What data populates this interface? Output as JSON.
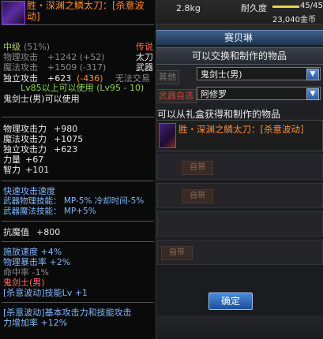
{
  "topbar": {
    "weight": "2.8kg",
    "durability_label": "耐久度",
    "durability_value": "45/45",
    "gold": "23,040金币"
  },
  "craft_window": {
    "title": "赛贝琳",
    "subtitle": "可以交换和制作的物品",
    "class_select": "鬼剑士(男)",
    "subclass_select": "阿修罗",
    "ghost_tab_1": "其他",
    "ghost_tab_2": "武器自选",
    "source_label": "可以从礼盒获得和制作的物品",
    "item_name": "胜・深渊之鳞太刀：[杀意波动]",
    "ghost_btn_1": "自带",
    "ghost_btn_2": "自带",
    "ghost_btn_3": "自带",
    "confirm_label": "确定"
  },
  "tooltip": {
    "item_name": "胜・深渊之鳞太刀：[杀意波动]",
    "grade": "中级",
    "grade_pct": "(51%)",
    "rarity": "传说",
    "type": "太刀",
    "category": "武器",
    "phys_atk_label": "物理攻击",
    "phys_atk_value": "+1242 (+52)",
    "mag_atk_label": "魔法攻击",
    "mag_atk_value": "+1509 (-317)",
    "ind_atk_label": "独立攻击",
    "ind_atk_value": "+623",
    "ind_atk_diff": "(-436)",
    "tradable": "无法交易",
    "level_req": "Lv85以上可以使用 (Lv95 - 10)",
    "class_req": "鬼剑士(男)可以使用",
    "stats": [
      {
        "label": "物理攻击力",
        "value": "+980"
      },
      {
        "label": "魔法攻击力",
        "value": "+1075"
      },
      {
        "label": "独立攻击力",
        "value": "+623"
      },
      {
        "label": "力量",
        "value": "+67"
      },
      {
        "label": "智力",
        "value": "+101"
      }
    ],
    "fast_atk": "快速攻击速度",
    "weapon_phys_skill": "武器物理技能：  MP-5% 冷却时间-5%",
    "weapon_mag_skill": "武器魔法技能：  MP+5%",
    "resist_label": "抗魔值",
    "resist_value": "+800",
    "cast_speed": "施放速度 +4%",
    "phys_crit": "物理暴击率 +2%",
    "hit_rate": "命中率 -1%",
    "class_tag": "鬼剑士(男)",
    "skill_lv": "[杀意波动]技能Lv +1",
    "skill_bonus_1": "[杀意波动]基本攻击力和技能攻击",
    "skill_bonus_2": "力增加率 +12%"
  }
}
